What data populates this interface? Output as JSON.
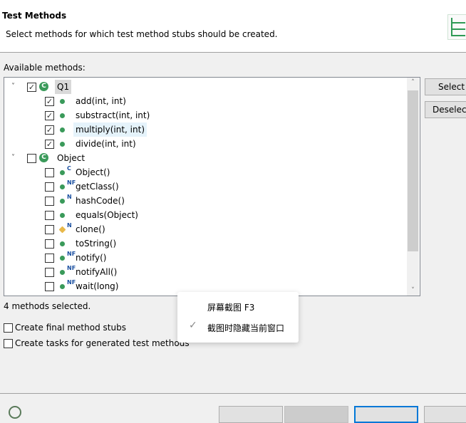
{
  "header": {
    "title": "Test Methods",
    "subtitle": "Select methods for which test method stubs should be created."
  },
  "available_label": "Available methods:",
  "tree": [
    {
      "label": "Q1",
      "kind": "class",
      "checked": true,
      "expanded": true,
      "level": 0
    },
    {
      "label": "add(int, int)",
      "kind": "public",
      "checked": true,
      "level": 1
    },
    {
      "label": "substract(int, int)",
      "kind": "public",
      "checked": true,
      "level": 1
    },
    {
      "label": "multiply(int, int)",
      "kind": "public",
      "checked": true,
      "level": 1,
      "hover": true
    },
    {
      "label": "divide(int, int)",
      "kind": "public",
      "checked": true,
      "level": 1
    },
    {
      "label": "Object",
      "kind": "class",
      "checked": false,
      "expanded": true,
      "level": 0
    },
    {
      "label": "Object()",
      "kind": "public",
      "mod": "C",
      "checked": false,
      "level": 1
    },
    {
      "label": "getClass()",
      "kind": "public",
      "mod": "NF",
      "checked": false,
      "level": 1
    },
    {
      "label": "hashCode()",
      "kind": "public",
      "mod": "N",
      "checked": false,
      "level": 1
    },
    {
      "label": "equals(Object)",
      "kind": "public",
      "checked": false,
      "level": 1
    },
    {
      "label": "clone()",
      "kind": "protected",
      "mod": "N",
      "checked": false,
      "level": 1
    },
    {
      "label": "toString()",
      "kind": "public",
      "checked": false,
      "level": 1
    },
    {
      "label": "notify()",
      "kind": "public",
      "mod": "NF",
      "checked": false,
      "level": 1
    },
    {
      "label": "notifyAll()",
      "kind": "public",
      "mod": "NF",
      "checked": false,
      "level": 1
    },
    {
      "label": "wait(long)",
      "kind": "public",
      "mod": "NF",
      "checked": false,
      "level": 1
    }
  ],
  "buttons": {
    "select_all": "Select All",
    "deselect_all": "Deselect All"
  },
  "status": "4 methods selected.",
  "options": [
    {
      "label": "Create final method stubs",
      "checked": false
    },
    {
      "label": "Create tasks for generated test methods",
      "checked": false
    }
  ],
  "context_menu": {
    "items": [
      {
        "label": "屏幕截图 F3",
        "checked": false
      },
      {
        "label": "截图时隐藏当前窗口",
        "checked": true
      }
    ]
  },
  "colors": {
    "method_public": "#3a9a5a",
    "method_protected": "#e8b84a",
    "modifier": "#1a4fa0"
  }
}
